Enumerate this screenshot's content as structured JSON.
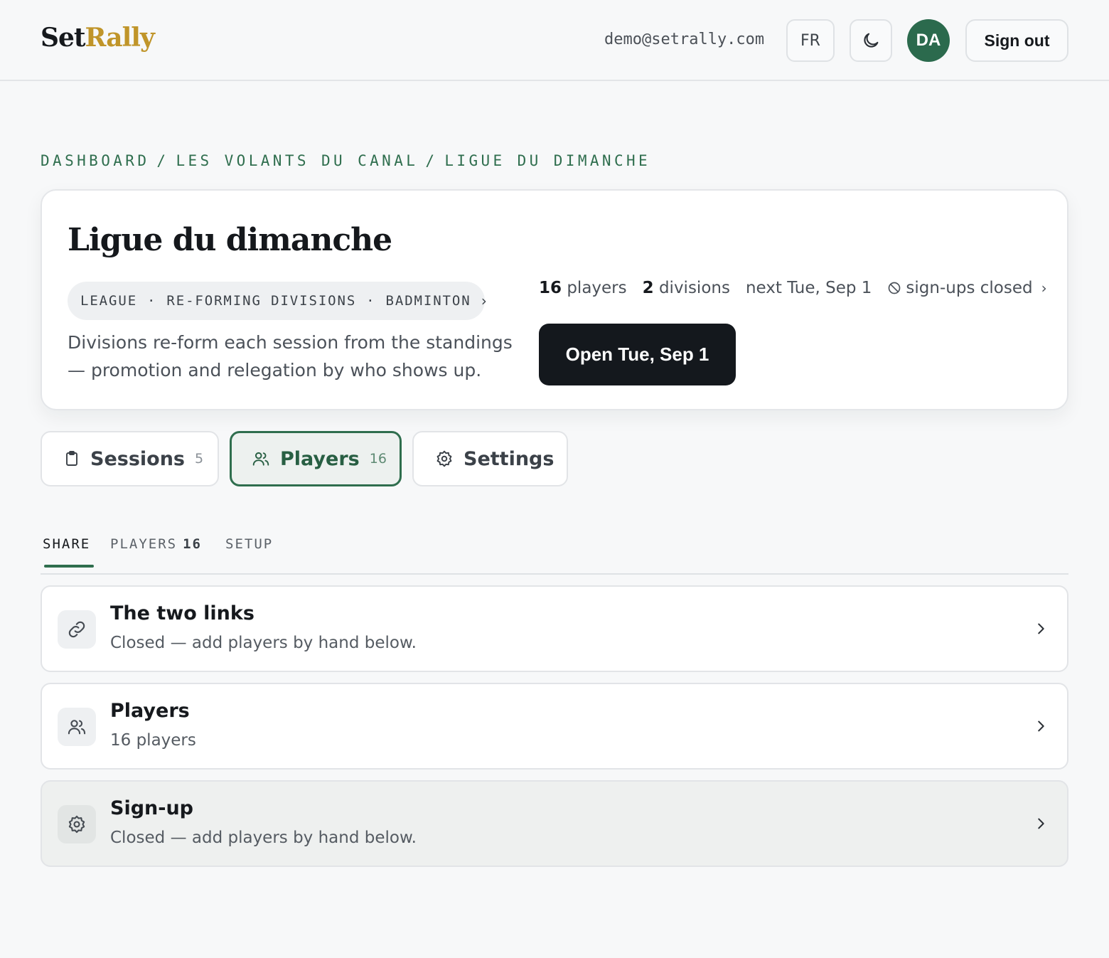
{
  "header": {
    "logo_set": "Set",
    "logo_rally": "Rally",
    "email": "demo@setrally.com",
    "lang_button": "FR",
    "avatar_initials": "DA",
    "sign_out": "Sign out"
  },
  "breadcrumb": [
    "DASHBOARD",
    "LES VOLANTS DU CANAL",
    "LIGUE DU DIMANCHE"
  ],
  "hero": {
    "title": "Ligue du dimanche",
    "chip": [
      "LEAGUE",
      "RE-FORMING DIVISIONS",
      "BADMINTON"
    ],
    "description": "Divisions re-form each session from the standings — promotion and relegation by who shows up.",
    "stats": {
      "players_count": "16",
      "players_label": "players",
      "divisions_count": "2",
      "divisions_label": "divisions",
      "next": "next Tue, Sep 1",
      "signups": "sign-ups closed"
    },
    "open_button": "Open Tue, Sep 1"
  },
  "section_tabs": [
    {
      "label": "Sessions",
      "count": "5",
      "icon": "clipboard-icon"
    },
    {
      "label": "Players",
      "count": "16",
      "icon": "users-icon",
      "active": true
    },
    {
      "label": "Settings",
      "count": "",
      "icon": "gear-icon"
    }
  ],
  "sub_tabs": [
    {
      "label": "SHARE",
      "count": "",
      "active": true
    },
    {
      "label": "PLAYERS",
      "count": "16"
    },
    {
      "label": "SETUP",
      "count": ""
    }
  ],
  "cards": [
    {
      "title": "The two links",
      "subtitle": "Closed — add players by hand below.",
      "icon": "link-icon"
    },
    {
      "title": "Players",
      "subtitle": "16 players",
      "icon": "users-icon"
    },
    {
      "title": "Sign-up",
      "subtitle": "Closed — add players by hand below.",
      "icon": "gear-icon"
    }
  ],
  "colors": {
    "accent": "#2f6e4e",
    "logo_gold": "#c0952a",
    "primary_button": "#14181d",
    "page_bg": "#f7f8f9"
  }
}
